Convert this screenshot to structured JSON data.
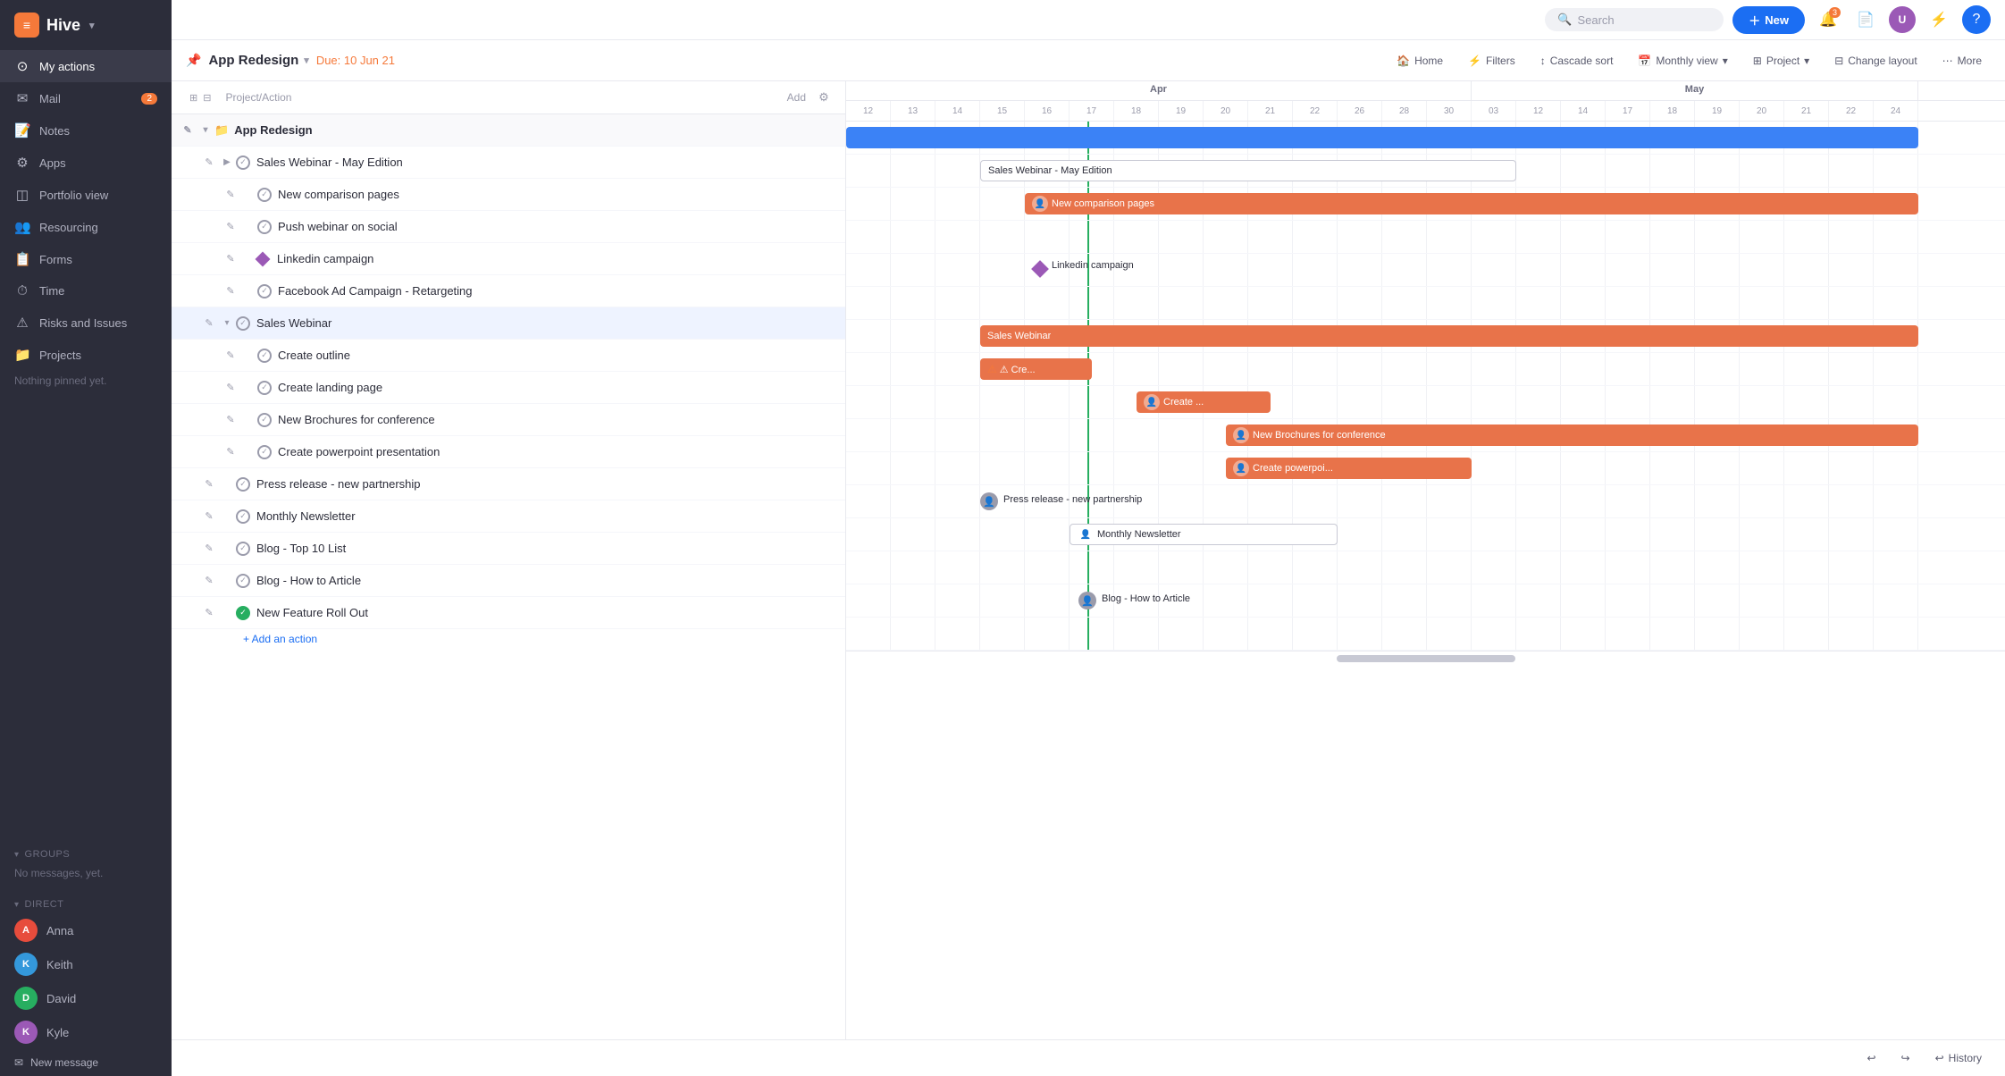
{
  "app": {
    "name": "Hive",
    "logo_text": "≡Hive"
  },
  "global_header": {
    "search_placeholder": "Search",
    "new_button_label": "+ New",
    "notification_count": "3"
  },
  "sidebar": {
    "nav_items": [
      {
        "id": "my-actions",
        "label": "My actions",
        "icon": "⊙",
        "badge": null
      },
      {
        "id": "mail",
        "label": "Mail",
        "icon": "✉",
        "badge": "2"
      },
      {
        "id": "notes",
        "label": "Notes",
        "icon": "📝",
        "badge": null
      },
      {
        "id": "apps",
        "label": "Apps",
        "icon": "⚙",
        "badge": null
      },
      {
        "id": "portfolio",
        "label": "Portfolio view",
        "icon": "◫",
        "badge": null
      },
      {
        "id": "resourcing",
        "label": "Resourcing",
        "icon": "👥",
        "badge": null
      },
      {
        "id": "forms",
        "label": "Forms",
        "icon": "📋",
        "badge": null
      },
      {
        "id": "time",
        "label": "Time",
        "icon": "⏱",
        "badge": null
      },
      {
        "id": "risks",
        "label": "Risks and Issues",
        "icon": "⚠",
        "badge": null
      },
      {
        "id": "projects",
        "label": "Projects",
        "icon": "📁",
        "badge": null
      }
    ],
    "pinned_note": "Nothing pinned yet.",
    "groups_label": "Groups",
    "groups_empty": "No messages, yet.",
    "direct_label": "Direct",
    "direct_messages": [
      {
        "id": "anna",
        "name": "Anna",
        "color": "#e74c3c"
      },
      {
        "id": "keith",
        "name": "Keith",
        "color": "#3498db"
      },
      {
        "id": "david",
        "name": "David",
        "color": "#27ae60"
      },
      {
        "id": "kyle",
        "name": "Kyle",
        "color": "#9b59b6"
      }
    ],
    "new_message_label": "New message"
  },
  "project_header": {
    "project_name": "App Redesign",
    "due_label": "Due: 10 Jun 21",
    "home_label": "Home",
    "filters_label": "Filters",
    "cascade_sort_label": "Cascade sort",
    "monthly_view_label": "Monthly view",
    "project_label": "Project",
    "change_layout_label": "Change layout",
    "more_label": "More"
  },
  "task_list": {
    "header_label": "Project/Action",
    "add_label": "Add",
    "tasks": [
      {
        "id": "app-redesign",
        "name": "App Redesign",
        "indent": 0,
        "type": "project",
        "expanded": true,
        "status": "none"
      },
      {
        "id": "sales-webinar-may",
        "name": "Sales Webinar  - May Edition",
        "indent": 1,
        "type": "group",
        "expanded": false,
        "status": "checked"
      },
      {
        "id": "new-comparison",
        "name": "New comparison pages",
        "indent": 2,
        "type": "task",
        "status": "checked"
      },
      {
        "id": "push-webinar",
        "name": "Push webinar on social",
        "indent": 2,
        "type": "task",
        "status": "checked"
      },
      {
        "id": "linkedin",
        "name": "Linkedin campaign",
        "indent": 2,
        "type": "milestone",
        "status": "none"
      },
      {
        "id": "facebook-ad",
        "name": "Facebook Ad Campaign - Retargeting",
        "indent": 2,
        "type": "task",
        "status": "checked"
      },
      {
        "id": "sales-webinar",
        "name": "Sales Webinar",
        "indent": 1,
        "type": "group",
        "expanded": true,
        "status": "checked",
        "selected": true
      },
      {
        "id": "create-outline",
        "name": "Create outline",
        "indent": 2,
        "type": "task",
        "status": "checked"
      },
      {
        "id": "create-landing",
        "name": "Create landing page",
        "indent": 2,
        "type": "task",
        "status": "checked"
      },
      {
        "id": "new-brochures",
        "name": "New Brochures for conference",
        "indent": 2,
        "type": "task",
        "status": "checked"
      },
      {
        "id": "create-powerpoint",
        "name": "Create powerpoint presentation",
        "indent": 2,
        "type": "task",
        "status": "checked"
      },
      {
        "id": "press-release",
        "name": "Press release - new partnership",
        "indent": 1,
        "type": "task",
        "status": "checked"
      },
      {
        "id": "monthly-newsletter",
        "name": "Monthly Newsletter",
        "indent": 1,
        "type": "task",
        "status": "checked"
      },
      {
        "id": "blog-top10",
        "name": "Blog - Top 10 List",
        "indent": 1,
        "type": "task",
        "status": "checked"
      },
      {
        "id": "blog-how-to",
        "name": "Blog - How to Article",
        "indent": 1,
        "type": "task",
        "status": "checked"
      },
      {
        "id": "new-feature",
        "name": "New Feature Roll Out",
        "indent": 1,
        "type": "task",
        "status": "done"
      }
    ],
    "add_action_label": "+ Add an action"
  },
  "gantt": {
    "months": [
      {
        "label": "Apr",
        "days_count": 14
      },
      {
        "label": "May",
        "days_count": 14
      }
    ],
    "apr_days": [
      "12",
      "13",
      "14",
      "15",
      "16",
      "17",
      "18",
      "19",
      "20",
      "21",
      "22",
      "26",
      "28",
      "30"
    ],
    "may_days": [
      "03",
      "12",
      "14",
      "17",
      "18",
      "19",
      "20",
      "21",
      "22",
      "24"
    ],
    "today_col": 5,
    "bars": [
      {
        "row": 0,
        "label": "",
        "color": "blue",
        "left_pct": 0,
        "width_pct": 100,
        "type": "full"
      },
      {
        "row": 1,
        "label": "Sales Webinar  - May Edition",
        "color": "outline",
        "left_pct": 5,
        "width_pct": 90
      },
      {
        "row": 2,
        "label": "New comparison pages",
        "color": "orange",
        "left_pct": 8,
        "width_pct": 85
      },
      {
        "row": 5,
        "label": "Sales Webinar",
        "color": "orange",
        "left_pct": 5,
        "width_pct": 92
      },
      {
        "row": 6,
        "label": "Cre...",
        "color": "orange",
        "left_pct": 5,
        "width_pct": 15,
        "warning": true
      },
      {
        "row": 7,
        "label": "Create ...",
        "color": "orange",
        "left_pct": 22,
        "width_pct": 18
      },
      {
        "row": 8,
        "label": "New Brochures for conference",
        "color": "orange",
        "left_pct": 28,
        "width_pct": 68
      },
      {
        "row": 9,
        "label": "Create powerpoi...",
        "color": "orange",
        "left_pct": 28,
        "width_pct": 30
      },
      {
        "row": 10,
        "label": "Press release - new partnership",
        "color": "none",
        "left_pct": 5,
        "width_pct": 0
      },
      {
        "row": 12,
        "label": "Blog - How to Article",
        "color": "none",
        "left_pct": 5,
        "width_pct": 0
      }
    ]
  },
  "bottom": {
    "history_label": "History",
    "undo_label": "↩",
    "redo_label": "↪"
  }
}
